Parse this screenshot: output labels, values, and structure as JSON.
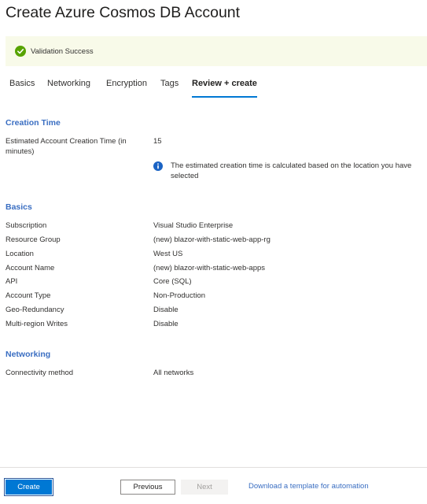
{
  "page": {
    "title": "Create Azure Cosmos DB Account"
  },
  "banner": {
    "icon": "check-circle-icon",
    "text": "Validation Success",
    "icon_color": "#57a300"
  },
  "tabs": [
    {
      "label": "Basics"
    },
    {
      "label": "Networking"
    },
    {
      "label": "Encryption"
    },
    {
      "label": "Tags"
    },
    {
      "label": "Review + create",
      "active": true
    }
  ],
  "creation_time": {
    "title": "Creation Time",
    "estimated_label": "Estimated Account Creation Time (in minutes)",
    "estimated_value": "15",
    "info_icon": "info-icon",
    "info_text": "The estimated creation time is calculated based on the location you have selected"
  },
  "basics": {
    "title": "Basics",
    "rows": [
      {
        "label": "Subscription",
        "value": "Visual Studio Enterprise"
      },
      {
        "label": "Resource Group",
        "value": "(new) blazor-with-static-web-app-rg"
      },
      {
        "label": "Location",
        "value": "West US"
      },
      {
        "label": "Account Name",
        "value": "(new) blazor-with-static-web-apps"
      },
      {
        "label": "API",
        "value": "Core (SQL)"
      },
      {
        "label": "Account Type",
        "value": "Non-Production"
      },
      {
        "label": "Geo-Redundancy",
        "value": "Disable"
      },
      {
        "label": "Multi-region Writes",
        "value": "Disable"
      }
    ]
  },
  "networking": {
    "title": "Networking",
    "rows": [
      {
        "label": "Connectivity method",
        "value": "All networks"
      }
    ]
  },
  "footer": {
    "create_label": "Create",
    "previous_label": "Previous",
    "next_label": "Next",
    "template_link": "Download a template for automation"
  },
  "colors": {
    "accent": "#0078d4",
    "section_title": "#3a6ec2",
    "banner_bg": "#f8fae9"
  }
}
